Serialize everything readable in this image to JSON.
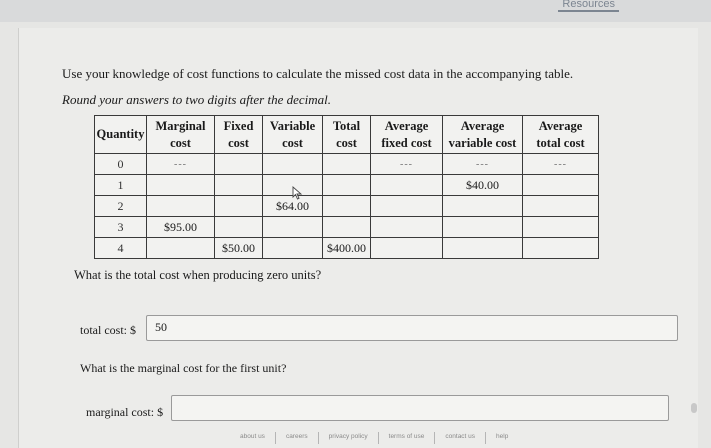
{
  "header": {
    "resources_label": "Resources"
  },
  "instructions": {
    "line1": "Use your knowledge of cost functions to calculate the missed cost data in the accompanying table.",
    "line2": "Round your answers to two digits after the decimal."
  },
  "table": {
    "headers": [
      {
        "top": "Quantity",
        "bottom": ""
      },
      {
        "top": "Marginal",
        "bottom": "cost"
      },
      {
        "top": "Fixed",
        "bottom": "cost"
      },
      {
        "top": "Variable",
        "bottom": "cost"
      },
      {
        "top": "Total",
        "bottom": "cost"
      },
      {
        "top": "Average",
        "bottom": "fixed cost"
      },
      {
        "top": "Average",
        "bottom": "variable cost"
      },
      {
        "top": "Average",
        "bottom": "total cost"
      }
    ],
    "rows": [
      [
        "0",
        "---",
        "",
        "",
        "",
        "---",
        "---",
        "---"
      ],
      [
        "1",
        "",
        "",
        "",
        "",
        "",
        "$40.00",
        ""
      ],
      [
        "2",
        "",
        "",
        "$64.00",
        "",
        "",
        "",
        ""
      ],
      [
        "3",
        "$95.00",
        "",
        "",
        "",
        "",
        "",
        ""
      ],
      [
        "4",
        "",
        "$50.00",
        "",
        "$400.00",
        "",
        "",
        ""
      ]
    ]
  },
  "question1": {
    "text": "What is the total cost when producing zero units?",
    "label": "total cost: $",
    "value": "50"
  },
  "question2": {
    "text": "What is the marginal cost for the first unit?",
    "label": "marginal cost: $",
    "value": ""
  },
  "footer": {
    "links": [
      "about us",
      "careers",
      "privacy policy",
      "terms of use",
      "contact us",
      "help"
    ]
  }
}
